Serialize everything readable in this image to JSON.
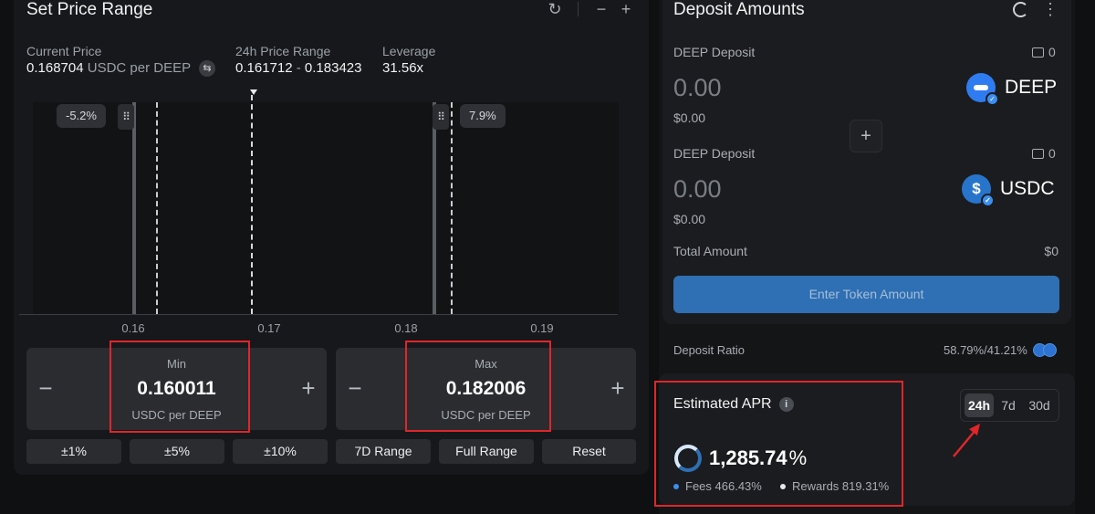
{
  "range_panel": {
    "title": "Set Price Range",
    "current_price_label": "Current Price",
    "current_price_value": "0.168704",
    "current_price_unit": "USDC per DEEP",
    "range_label": "24h Price Range",
    "range_low": "0.161712",
    "range_sep": "-",
    "range_high": "0.183423",
    "leverage_label": "Leverage",
    "leverage_value": "31.56x",
    "lower_pct": "-5.2%",
    "upper_pct": "7.9%",
    "ticks": [
      "0.16",
      "0.17",
      "0.18",
      "0.19"
    ],
    "min_label": "Min",
    "min_value": "0.160011",
    "min_unit": "USDC per DEEP",
    "max_label": "Max",
    "max_value": "0.182006",
    "max_unit": "USDC per DEEP",
    "minus": "−",
    "plus": "+",
    "presets": [
      "±1%",
      "±5%",
      "±10%",
      "7D Range",
      "Full Range",
      "Reset"
    ]
  },
  "deposit": {
    "title": "Deposit Amounts",
    "token_a": {
      "label": "DEEP Deposit",
      "balance": "0",
      "amount": "0.00",
      "usd": "$0.00",
      "symbol": "DEEP"
    },
    "token_b": {
      "label": "DEEP Deposit",
      "balance": "0",
      "amount": "0.00",
      "usd": "$0.00",
      "symbol": "USDC"
    },
    "plus": "+",
    "total_label": "Total Amount",
    "total_value": "$0",
    "button_label": "Enter Token Amount",
    "ratio_label": "Deposit Ratio",
    "ratio_value": "58.79%/41.21%"
  },
  "apr": {
    "title": "Estimated APR",
    "info": "i",
    "value": "1,285.74",
    "suffix": "%",
    "fees": "Fees 466.43%",
    "rewards": "Rewards 819.31%",
    "periods": [
      "24h",
      "7d",
      "30d"
    ],
    "active_period": "24h"
  },
  "colors": {
    "accent": "#2f6fb3",
    "highlight_frame": "#e0262a",
    "deep_logo": "#2f7cf0",
    "usdc_logo": "#2775ca"
  }
}
